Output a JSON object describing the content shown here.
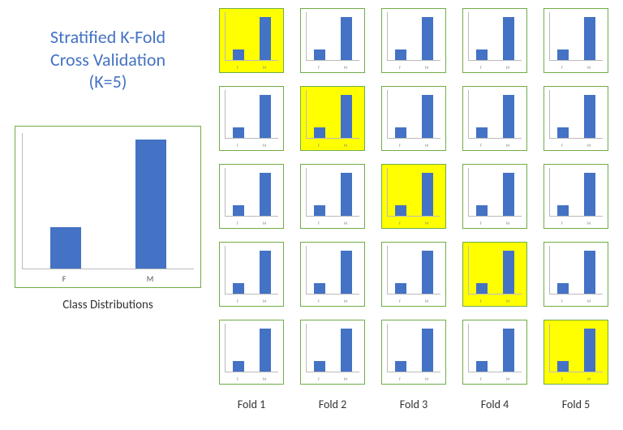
{
  "title_line1": "Stratified K-Fold",
  "title_line2": "Cross Validation",
  "title_line3": "(K=5)",
  "big_chart_caption": "Class Distributions",
  "categories": [
    "F",
    "M"
  ],
  "fold_labels": [
    "Fold 1",
    "Fold 2",
    "Fold 3",
    "Fold 4",
    "Fold 5"
  ],
  "chart_data": {
    "type": "bar",
    "title": "Class Distributions",
    "categories": [
      "F",
      "M"
    ],
    "values": [
      30,
      95
    ],
    "ylim": [
      0,
      100
    ],
    "note": "Overall class distribution; values estimated from bar heights (approx 30% vs 95% of chart height, relative scale).",
    "folds": {
      "description": "5x5 grid of mini bar charts. Each row corresponds to one cross-validation iteration; the highlighted (yellow) cell is the test fold for that iteration (diagonal). Every mini chart shows the same two-class distribution shape (F smaller, M larger), indicating stratification preserves class ratio across folds.",
      "per_cell_values": [
        22,
        90
      ],
      "highlight_diagonal": true
    }
  }
}
